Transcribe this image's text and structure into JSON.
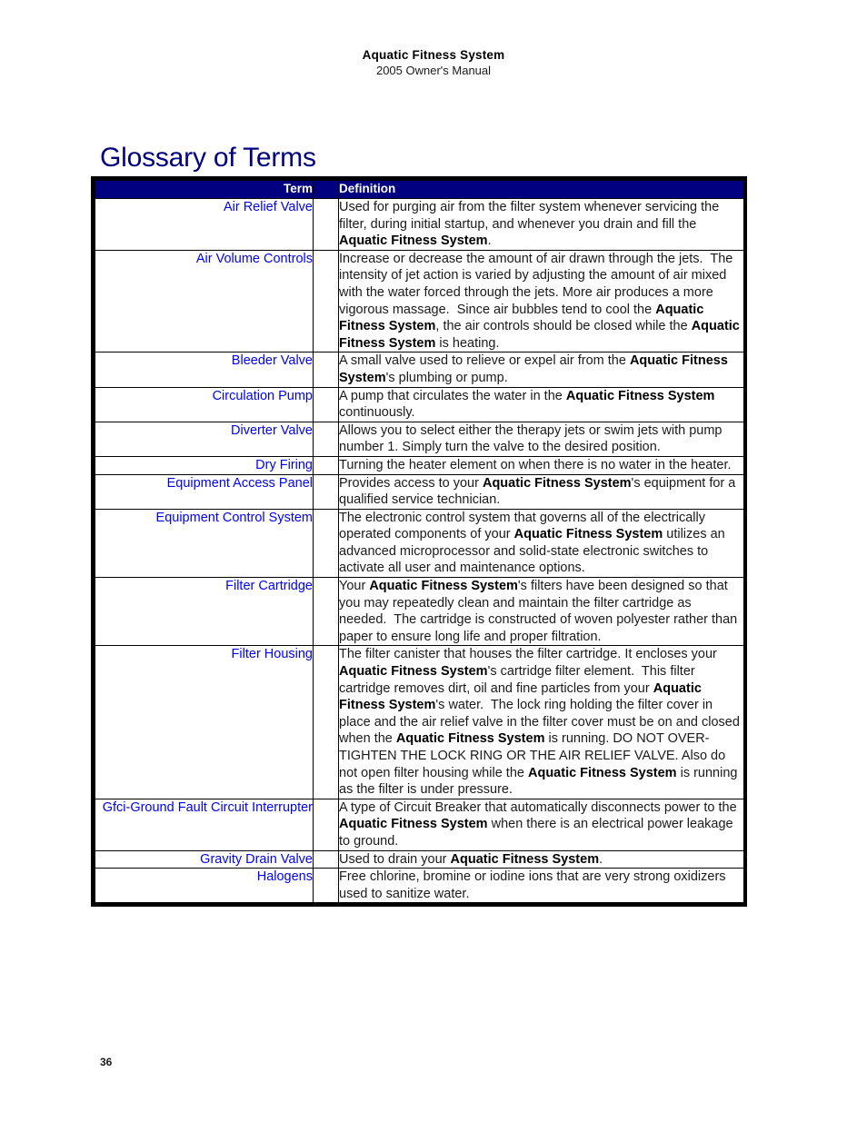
{
  "header": {
    "title": "Aquatic Fitness System",
    "subtitle": "2005 Owner's Manual"
  },
  "page_title": "Glossary of Terms",
  "folio": "36",
  "colors": {
    "heading": "#000080",
    "table_header_bg": "#000080",
    "table_header_text": "#ffffff",
    "term_text": "#0000ff",
    "definition_text": "#1a1a1a",
    "border": "#000000"
  },
  "table": {
    "columns": [
      "Term",
      "",
      "Definition"
    ],
    "headers": {
      "term": "Term",
      "definition": "Definition"
    },
    "rows": [
      {
        "term": "Air Relief Valve",
        "definition_html": "Used for purging air from the filter system whenever servicing the filter, during initial startup, and whenever you drain and fill the <b>Aquatic Fitness System</b>."
      },
      {
        "term": "Air Volume Controls",
        "definition_html": "Increase or decrease the amount of air drawn through the jets.&nbsp; The intensity of jet action is varied by adjusting the amount of air mixed with the water forced through the jets. More air produces a more vigorous massage.&nbsp; Since air bubbles tend to cool the <b>Aquatic Fitness System</b>, the air controls should be closed while the <b>Aquatic Fitness System</b> is heating."
      },
      {
        "term": "Bleeder Valve",
        "definition_html": "A small valve used to relieve or expel air from the <b>Aquatic Fitness System</b>'s plumbing or pump."
      },
      {
        "term": "Circulation Pump",
        "definition_html": "A pump that circulates the water in the <b>Aquatic Fitness System</b> continuously."
      },
      {
        "term": "Diverter Valve",
        "definition_html": "Allows you to select either the therapy jets or swim jets with pump number 1. Simply turn the valve to the desired position."
      },
      {
        "term": "Dry Firing",
        "definition_html": "Turning the heater element on when there is no water in the heater."
      },
      {
        "term": "Equipment Access Panel",
        "definition_html": "Provides access to your <b>Aquatic Fitness System</b>'s equipment for a qualified service technician."
      },
      {
        "term": "Equipment Control System",
        "definition_html": "The electronic control system that governs all of the electrically operated components of your <b>Aquatic Fitness System</b> utilizes an advanced microprocessor and solid-state electronic switches to activate all user and maintenance options."
      },
      {
        "term": "Filter Cartridge",
        "definition_html": "Your <b>Aquatic Fitness System</b>'s filters have been designed so that you may repeatedly clean and maintain the filter cartridge as needed.&nbsp; The cartridge is constructed of woven polyester rather than paper to ensure long life and proper filtration."
      },
      {
        "term": "Filter Housing",
        "definition_html": "The filter canister that houses the filter cartridge. It encloses your <b>Aquatic Fitness System</b>'s cartridge filter element.&nbsp; This filter cartridge removes dirt, oil and fine particles from your <b>Aquatic Fitness System</b>'s water.&nbsp; The lock ring holding the filter cover in place and the air relief valve in the filter cover must be on and closed when the <b>Aquatic Fitness System</b> is running. DO NOT OVER-TIGHTEN THE LOCK RING OR THE AIR RELIEF VALVE. Also do not open filter housing while the <b>Aquatic Fitness System</b> is running as the filter is under pressure."
      },
      {
        "term": "Gfci-Ground Fault Circuit Interrupter",
        "definition_html": "A type of Circuit Breaker that automatically disconnects power to the <b>Aquatic Fitness System</b> when there is an electrical power leakage to ground."
      },
      {
        "term": "Gravity Drain Valve",
        "definition_html": "Used to drain your <b>Aquatic Fitness System</b>."
      },
      {
        "term": "Halogens",
        "definition_html": "Free chlorine, bromine or iodine ions that are very strong oxidizers used to sanitize water."
      }
    ]
  }
}
